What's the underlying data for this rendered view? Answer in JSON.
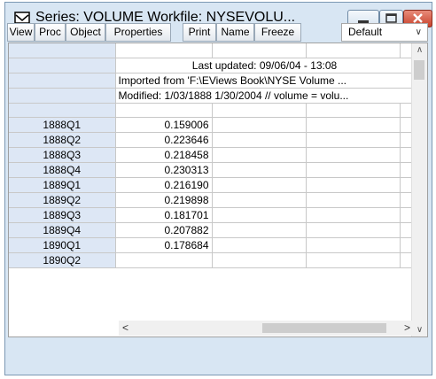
{
  "window": {
    "title": "Series: VOLUME   Workfile: NYSEVOLU...",
    "controls": [
      "minimize",
      "maximize",
      "close"
    ]
  },
  "toolbar": {
    "buttons": [
      "View",
      "Proc",
      "Object",
      "Properties",
      "Print",
      "Name",
      "Freeze"
    ],
    "dropdown_value": "Default"
  },
  "header": {
    "last_updated": "Last updated: 09/06/04 - 13:08",
    "imported": "Imported from 'F:\\EViews Book\\NYSE Volume ...",
    "modified": "Modified: 1/03/1888 1/30/2004 // volume = volu..."
  },
  "rows": [
    {
      "label": "1888Q1",
      "value": "0.159006"
    },
    {
      "label": "1888Q2",
      "value": "0.223646"
    },
    {
      "label": "1888Q3",
      "value": "0.218458"
    },
    {
      "label": "1888Q4",
      "value": "0.230313"
    },
    {
      "label": "1889Q1",
      "value": "0.216190"
    },
    {
      "label": "1889Q2",
      "value": "0.219898"
    },
    {
      "label": "1889Q3",
      "value": "0.181701"
    },
    {
      "label": "1889Q4",
      "value": "0.207882"
    },
    {
      "label": "1890Q1",
      "value": "0.178684"
    },
    {
      "label": "1890Q2",
      "value": ""
    }
  ],
  "colors": {
    "window_bg": "#d8e6f3",
    "row_header_bg": "#dde7f5",
    "close_button": "#c8432d"
  }
}
